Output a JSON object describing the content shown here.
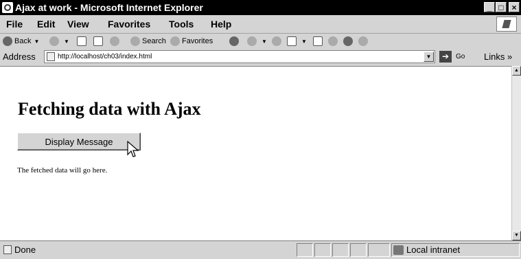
{
  "window": {
    "title": "Ajax at work - Microsoft Internet Explorer",
    "min_label": "_",
    "max_label": "□",
    "close_label": "×"
  },
  "menu": {
    "items": [
      "File",
      "Edit",
      "View",
      "Favorites",
      "Tools",
      "Help"
    ]
  },
  "toolbar": {
    "back_label": "Back",
    "search_label": "Search",
    "favorites_label": "Favorites"
  },
  "address": {
    "label": "Address",
    "url": "http://localhost/ch03/index.html",
    "go_label": "Go",
    "links_label": "Links »"
  },
  "page": {
    "heading": "Fetching data with Ajax",
    "button_label": "Display Message",
    "message": "The fetched data will go here."
  },
  "status": {
    "text": "Done",
    "zone": "Local intranet"
  }
}
